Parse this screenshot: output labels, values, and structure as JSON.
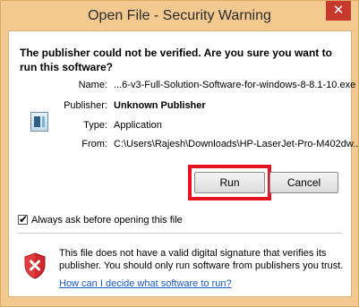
{
  "window": {
    "title": "Open File - Security Warning",
    "close_glyph": "✕"
  },
  "headline": "The publisher could not be verified.  Are you sure you want to run this software?",
  "details": {
    "name_label": "Name:",
    "name_value": "...6-v3-Full-Solution-Software-for-windows-8-8.1-10.exe",
    "publisher_label": "Publisher:",
    "publisher_value": "Unknown Publisher",
    "type_label": "Type:",
    "type_value": "Application",
    "from_label": "From:",
    "from_value": "C:\\Users\\Rajesh\\Downloads\\HP-LaserJet-Pro-M402dw..."
  },
  "buttons": {
    "run": "Run",
    "cancel": "Cancel"
  },
  "checkbox": {
    "label": "Always ask before opening this file",
    "checked": true
  },
  "warning": {
    "text": "This file does not have a valid digital signature that verifies its publisher.  You should only run software from publishers you trust.",
    "link": "How can I decide what software to run?"
  },
  "icons": {
    "file": "application-file-icon",
    "shield": "security-shield-icon",
    "close": "close-icon"
  },
  "colors": {
    "window_frame": "#f3c990",
    "highlight": "#e3131f",
    "link": "#1a57b6",
    "close_button": "#c7382d"
  }
}
